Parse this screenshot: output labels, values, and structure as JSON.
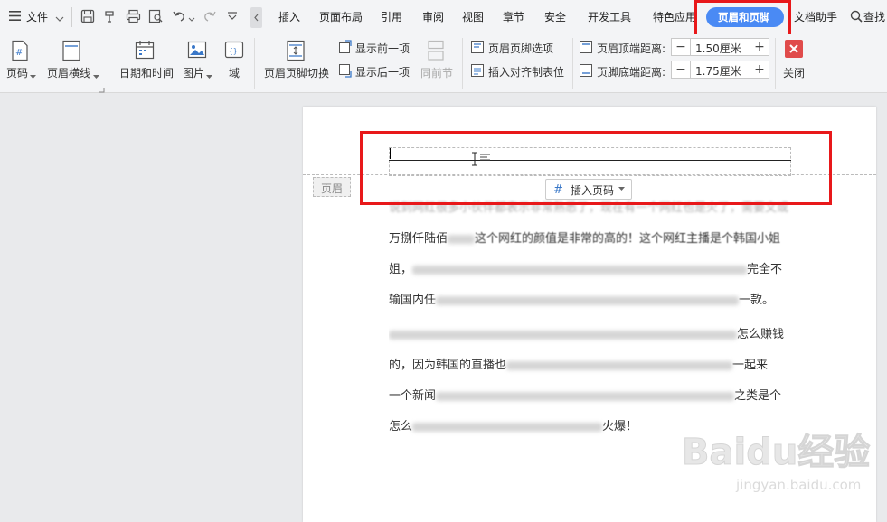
{
  "menubar": {
    "file_label": "文件",
    "tabs": [
      "插入",
      "页面布局",
      "引用",
      "审阅",
      "视图",
      "章节",
      "安全",
      "开发工具",
      "特色应用",
      "页眉和页脚",
      "文档助手"
    ],
    "search_label": "查找"
  },
  "ribbon": {
    "page_number": "页码",
    "header_line": "页眉横线",
    "date_time": "日期和时间",
    "picture": "图片",
    "field": "域",
    "switch": "页眉页脚切换",
    "show_prev": "显示前一项",
    "show_next": "显示后一项",
    "same_as_prev": "同前节",
    "hf_options": "页眉页脚选项",
    "insert_tab": "插入对齐制表位",
    "header_top_label": "页眉顶端距离:",
    "header_top_value": "1.50厘米",
    "footer_bottom_label": "页脚底端距离:",
    "footer_bottom_value": "1.75厘米",
    "close": "关闭"
  },
  "document": {
    "header_tag": "页眉",
    "insert_page_number": "插入页码",
    "paragraphs": [
      {
        "lines": [
          {
            "pre": "说到网红很多小伙伴都表示非常熟悉了，现在有一个网红也是火了，需要文或",
            "blur": []
          },
          {
            "pre": "万捌仟陆佰",
            "post": "这个网红的颜值是非常的高的！这个网红主播是个韩国小姐",
            "blur": [
              1
            ]
          },
          {
            "pre": "姐，",
            "post": "完全不",
            "blur": [
              2
            ]
          },
          {
            "pre": "输国内任",
            "post": "一款。",
            "blur": [
              3
            ]
          }
        ]
      },
      {
        "lines": [
          {
            "pre": "",
            "post": "怎么赚钱",
            "blur": [
              4
            ]
          },
          {
            "pre": "的，因为韩国的直播也",
            "post": "一起来",
            "blur": [
              5
            ]
          },
          {
            "pre": "一个新闻",
            "post": "之类是个",
            "blur": [
              6
            ]
          },
          {
            "pre": "怎么",
            "post": "火爆！",
            "blur": [
              7
            ]
          }
        ]
      }
    ]
  },
  "watermark": {
    "brand": "Baidu经验",
    "url": "jingyan.baidu.com"
  },
  "colors": {
    "highlight_red": "#e8181a",
    "active_tab_bg": "#4a8af4",
    "close_red": "#e04b4b"
  }
}
